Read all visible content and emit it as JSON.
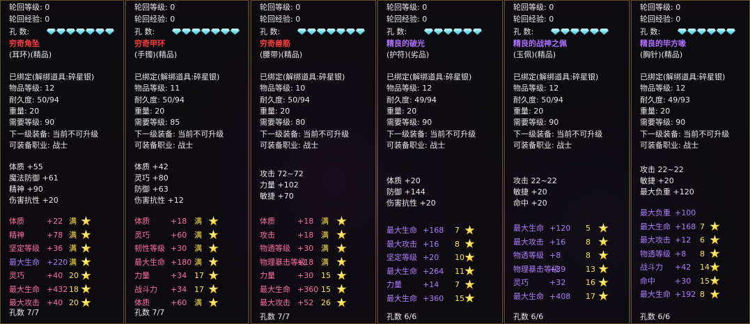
{
  "colors": {
    "white": "#e8e8e8",
    "orange_name": "#ff3c3c",
    "purple_name": "#b070ff",
    "pink_refine": "#ff6ea0",
    "purple_refine": "#b07cff",
    "star": "#ffd21e",
    "gem": "#7fe3f2"
  },
  "panels": [
    {
      "reincarnation_level": "轮回等级: 0",
      "reincarnation_exp": "轮回经验: 0",
      "socket_label": "孔    数:",
      "gem_count": 7,
      "name": "穷奇角坠",
      "name_color": "#ff3c3c",
      "subtitle": "(耳环)(精品)",
      "bound": "已绑定(解绑道具:碎星银)",
      "item_level": "物品等级: 12",
      "durability": "耐久度: 50/94",
      "weight": "重量: 20",
      "req_level": "需要等级: 90",
      "next_equip": "下一级装备: 当前不可升级",
      "job": "可装备职业: 战士",
      "base_stats": [
        "体质 +55",
        "魔法防御 +61",
        "精神 +90",
        "伤害抗性 +20"
      ],
      "refines": [
        {
          "label": "体质",
          "value": "+22",
          "level": "满",
          "color": "#ff6ea0"
        },
        {
          "label": "精神",
          "value": "+78",
          "level": "满",
          "color": "#ff6ea0"
        },
        {
          "label": "坚定等级",
          "value": "+36",
          "level": "满",
          "color": "#ff6ea0"
        },
        {
          "label": "最大生命",
          "value": "+220",
          "level": "满",
          "color": "#b07cff"
        },
        {
          "label": "灵巧",
          "value": "+40",
          "level": "20",
          "color": "#ff6ea0"
        },
        {
          "label": "最大生命",
          "value": "+432",
          "level": "18",
          "color": "#ff6ea0"
        },
        {
          "label": "最大攻击",
          "value": "+40",
          "level": "20",
          "color": "#ff6ea0"
        }
      ],
      "footer": "孔数 7/7"
    },
    {
      "reincarnation_level": "轮回等级: 0",
      "reincarnation_exp": "轮回经验: 0",
      "socket_label": "孔    数:",
      "gem_count": 7,
      "name": "穷奇甲环",
      "name_color": "#ff3c3c",
      "subtitle": "(手镯)(精品)",
      "bound": "已绑定(解绑道具:碎星银)",
      "item_level": "物品等级: 11",
      "durability": "耐久度: 50/94",
      "weight": "重量: 20",
      "req_level": "需要等级: 85",
      "next_equip": "下一级装备: 当前不可升级",
      "job": "可装备职业: 战士",
      "base_stats": [
        "体质 +42",
        "灵巧 +80",
        "防御 +63",
        "伤害抗性 +12"
      ],
      "refines": [
        {
          "label": "体质",
          "value": "+18",
          "level": "满",
          "color": "#ff6ea0"
        },
        {
          "label": "灵巧",
          "value": "+60",
          "level": "满",
          "color": "#ff6ea0"
        },
        {
          "label": "韧性等级",
          "value": "+30",
          "level": "满",
          "color": "#ff6ea0"
        },
        {
          "label": "最大生命",
          "value": "+180",
          "level": "满",
          "color": "#ff6ea0"
        },
        {
          "label": "力量",
          "value": "+34",
          "level": "17",
          "color": "#ff6ea0"
        },
        {
          "label": "战斗力",
          "value": "+34",
          "level": "17",
          "color": "#ff6ea0"
        },
        {
          "label": "体质",
          "value": "+60",
          "level": "满",
          "color": "#ff6ea0"
        }
      ],
      "footer": "孔数 7/7"
    },
    {
      "reincarnation_level": "轮回等级: 0",
      "reincarnation_exp": "轮回经验: 0",
      "socket_label": "孔    数:",
      "gem_count": 7,
      "name": "穷奇兽筋",
      "name_color": "#ff3c3c",
      "subtitle": "(腰带)(精品)",
      "bound": "已绑定(解绑道具:碎星银)",
      "item_level": "物品等级: 10",
      "durability": "耐久度: 50/94",
      "weight": "重量: 20",
      "req_level": "需要等级: 80",
      "next_equip": "下一级装备: 当前不可升级",
      "job": "可装备职业: 战士",
      "base_stats": [
        "攻击 72~72",
        "力量 +102",
        "敏捷 +70"
      ],
      "refines": [
        {
          "label": "体质",
          "value": "+18",
          "level": "满",
          "color": "#ff6ea0"
        },
        {
          "label": "攻击",
          "value": "+18",
          "level": "满",
          "color": "#ff6ea0"
        },
        {
          "label": "物透等级",
          "value": "+30",
          "level": "满",
          "color": "#ff6ea0"
        },
        {
          "label": "物理暴击等级",
          "value": "+18",
          "level": "满",
          "color": "#ff6ea0"
        },
        {
          "label": "力量",
          "value": "+30",
          "level": "15",
          "color": "#ff6ea0"
        },
        {
          "label": "最大生命",
          "value": "+360",
          "level": "15",
          "color": "#ff6ea0"
        },
        {
          "label": "最大攻击",
          "value": "+52",
          "level": "26",
          "color": "#ff6ea0"
        }
      ],
      "footer": "孔数 7/7"
    },
    {
      "reincarnation_level": "轮回等级: 0",
      "reincarnation_exp": "轮回经验: 0",
      "socket_label": "孔    数:",
      "gem_count": 6,
      "name": "精良的破光",
      "name_color": "#b070ff",
      "subtitle": "(护符)(劣品)",
      "bound": "已绑定(解绑道具:碎星银)",
      "item_level": "物品等级: 12",
      "durability": "耐久度: 49/94",
      "weight": "重量: 20",
      "req_level": "需要等级: 90",
      "next_equip": "下一级装备: 当前不可升级",
      "job": "可装备职业: 战士",
      "base_stats": [
        "体质 +20",
        "防御 +144",
        "伤害抗性 +20"
      ],
      "refines": [
        {
          "label": "最大生命",
          "value": "+168",
          "level": "7",
          "color": "#b07cff"
        },
        {
          "label": "最大攻击",
          "value": "+16",
          "level": "8",
          "color": "#b07cff"
        },
        {
          "label": "坚定等级",
          "value": "+20",
          "level": "10",
          "color": "#b07cff"
        },
        {
          "label": "最大生命",
          "value": "+264",
          "level": "11",
          "color": "#b07cff"
        },
        {
          "label": "力量",
          "value": "+14",
          "level": "7",
          "color": "#b07cff"
        },
        {
          "label": "最大生命",
          "value": "+360",
          "level": "15",
          "color": "#b07cff"
        }
      ],
      "footer": "孔数 6/6"
    },
    {
      "reincarnation_level": "轮回等级: 0",
      "reincarnation_exp": "轮回经验: 0",
      "socket_label": "孔    数:",
      "gem_count": 6,
      "name": "精良的战神之佩",
      "name_color": "#b070ff",
      "subtitle": "(玉佩)(精品)",
      "bound": "已绑定(解绑道具:碎星银)",
      "item_level": "物品等级: 12",
      "durability": "耐久度: 50/94",
      "weight": "重量: 20",
      "req_level": "需要等级: 90",
      "next_equip": "下一级装备: 当前不可升级",
      "job": "可装备职业: 战士",
      "base_stats": [
        "攻击 22~22",
        "敏捷 +20",
        "命中 +20"
      ],
      "refines": [
        {
          "label": "最大生命",
          "value": "+120",
          "level": "5",
          "color": "#b07cff"
        },
        {
          "label": "最大攻击",
          "value": "+16",
          "level": "8",
          "color": "#b07cff"
        },
        {
          "label": "物透等级",
          "value": "+8",
          "level": "8",
          "color": "#b07cff"
        },
        {
          "label": "物理暴击等级",
          "value": "+39",
          "level": "13",
          "color": "#b07cff"
        },
        {
          "label": "灵巧",
          "value": "+32",
          "level": "16",
          "color": "#b07cff"
        },
        {
          "label": "最大生命",
          "value": "+408",
          "level": "17",
          "color": "#b07cff"
        }
      ],
      "footer": "孔数 6/6"
    },
    {
      "reincarnation_level": "轮回等级: 0",
      "reincarnation_exp": "轮回经验: 0",
      "socket_label": "孔    数:",
      "gem_count": 6,
      "name": "精良的毕方喙",
      "name_color": "#b070ff",
      "subtitle": "(胸针)(精品)",
      "bound": "已绑定(解绑道具:碎星银)",
      "item_level": "物品等级: 12",
      "durability": "耐久度: 49/93",
      "weight": "重量: 20",
      "req_level": "需要等级: 90",
      "next_equip": "下一级装备: 当前不可升级",
      "job": "可装备职业: 战士",
      "base_stats": [
        "攻击 22~22",
        "敏捷 +20",
        "最大负重 +120"
      ],
      "refines": [
        {
          "label": "最大负重",
          "value": "+100",
          "level": "",
          "color": "#b07cff"
        },
        {
          "label": "最大生命",
          "value": "+168",
          "level": "7",
          "color": "#b07cff"
        },
        {
          "label": "最大攻击",
          "value": "+12",
          "level": "6",
          "color": "#b07cff"
        },
        {
          "label": "物透等级",
          "value": "+8",
          "level": "8",
          "color": "#b07cff"
        },
        {
          "label": "战斗力",
          "value": "+42",
          "level": "14",
          "color": "#b07cff"
        },
        {
          "label": "命中",
          "value": "+30",
          "level": "15",
          "color": "#b07cff"
        },
        {
          "label": "最大生命",
          "value": "+192",
          "level": "8",
          "color": "#b07cff"
        }
      ],
      "footer": "孔数 6/6"
    }
  ]
}
